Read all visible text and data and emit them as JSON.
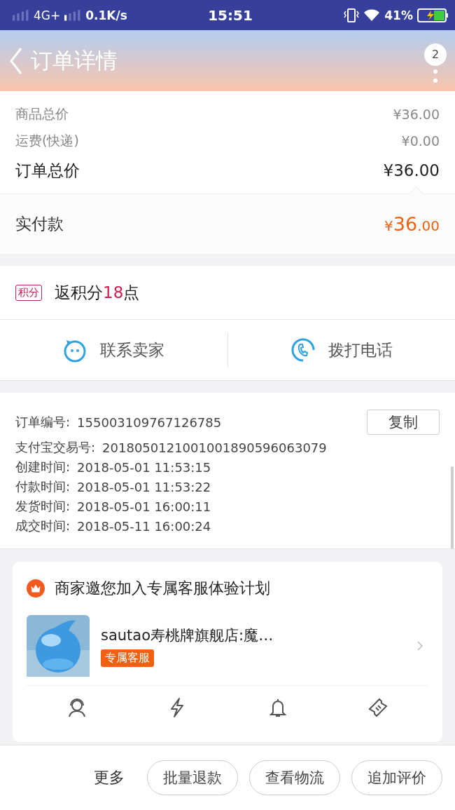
{
  "status_bar": {
    "network": "4G+",
    "speed": "0.1K/s",
    "time": "15:51",
    "battery": "41%"
  },
  "header": {
    "title": "订单详情",
    "badge": "2"
  },
  "prices": [
    {
      "label": "商品总价",
      "value": "¥36.00",
      "kind": "minor"
    },
    {
      "label": "运费(快递)",
      "value": "¥0.00",
      "kind": "minor"
    },
    {
      "label": "订单总价",
      "value": "¥36.00",
      "kind": "major"
    }
  ],
  "paid": {
    "label": "实付款",
    "currency": "¥",
    "integer": "36",
    "decimal": ".00"
  },
  "points": {
    "tag": "积分",
    "prefix": "返积分",
    "value": "18",
    "suffix": "点"
  },
  "actions": [
    {
      "kind": "chat",
      "label": "联系卖家"
    },
    {
      "kind": "phone",
      "label": "拨打电话"
    }
  ],
  "info": [
    {
      "label": "订单编号:",
      "value": "155003109767126785",
      "button": "复制"
    },
    {
      "label": "支付宝交易号:",
      "value": "2018050121001001890596063079"
    },
    {
      "label": "创建时间:",
      "value": "2018-05-01 11:53:15"
    },
    {
      "label": "付款时间:",
      "value": "2018-05-01 11:53:22"
    },
    {
      "label": "发货时间:",
      "value": "2018-05-01 16:00:11"
    },
    {
      "label": "成交时间:",
      "value": "2018-05-11 16:00:24"
    }
  ],
  "service_card": {
    "title": "商家邀您加入专属客服体验计划",
    "shop": "sautao寿桃牌旗舰店:魔…",
    "tag": "专属客服",
    "features": [
      {
        "kind": "agent"
      },
      {
        "kind": "bolt"
      },
      {
        "kind": "bell"
      },
      {
        "kind": "ticket"
      }
    ]
  },
  "bottom_bar": {
    "more": "更多",
    "buttons": [
      "批量退款",
      "查看物流",
      "追加评价"
    ]
  }
}
